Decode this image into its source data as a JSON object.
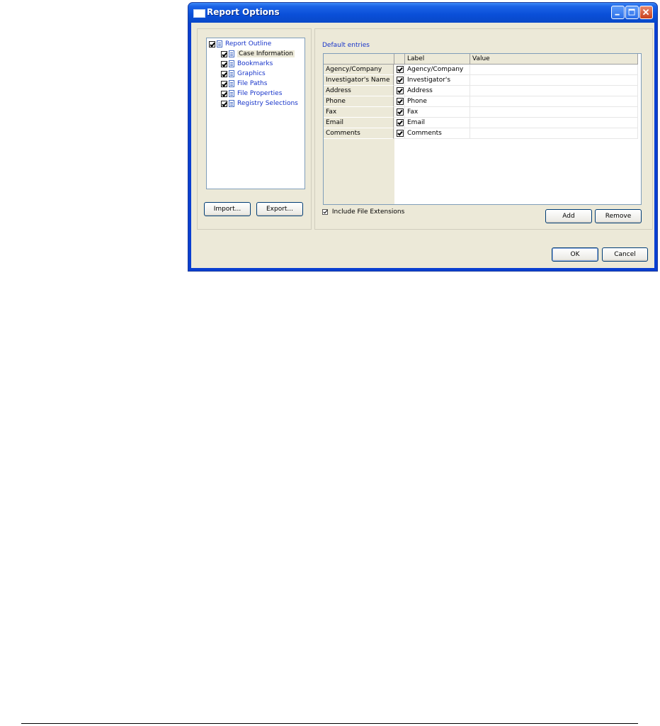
{
  "window": {
    "title": "Report Options"
  },
  "tree": {
    "root": {
      "label": "Report Outline",
      "checked": true
    },
    "items": [
      {
        "label": "Case Information",
        "checked": true,
        "selected": true
      },
      {
        "label": "Bookmarks",
        "checked": true,
        "selected": false
      },
      {
        "label": "Graphics",
        "checked": true,
        "selected": false
      },
      {
        "label": "File Paths",
        "checked": true,
        "selected": false
      },
      {
        "label": "File Properties",
        "checked": true,
        "selected": false
      },
      {
        "label": "Registry Selections",
        "checked": true,
        "selected": false
      }
    ]
  },
  "buttons": {
    "import": "Import...",
    "export": "Export...",
    "add": "Add",
    "remove": "Remove",
    "ok": "OK",
    "cancel": "Cancel"
  },
  "entries": {
    "section_label": "Default entries",
    "columns": {
      "label": "Label",
      "value": "Value"
    },
    "rows": [
      {
        "header": "Agency/Company",
        "label": "Agency/Company",
        "value": "",
        "checked": true
      },
      {
        "header": "Investigator's Name",
        "label": "Investigator's Name",
        "value": "",
        "checked": true
      },
      {
        "header": "Address",
        "label": "Address",
        "value": "",
        "checked": true
      },
      {
        "header": "Phone",
        "label": "Phone",
        "value": "",
        "checked": true
      },
      {
        "header": "Fax",
        "label": "Fax",
        "value": "",
        "checked": true
      },
      {
        "header": "Email",
        "label": "Email",
        "value": "",
        "checked": true
      },
      {
        "header": "Comments",
        "label": "Comments",
        "value": "",
        "checked": true
      }
    ]
  },
  "include_extensions": {
    "label": "Include File Extensions",
    "checked": true
  }
}
